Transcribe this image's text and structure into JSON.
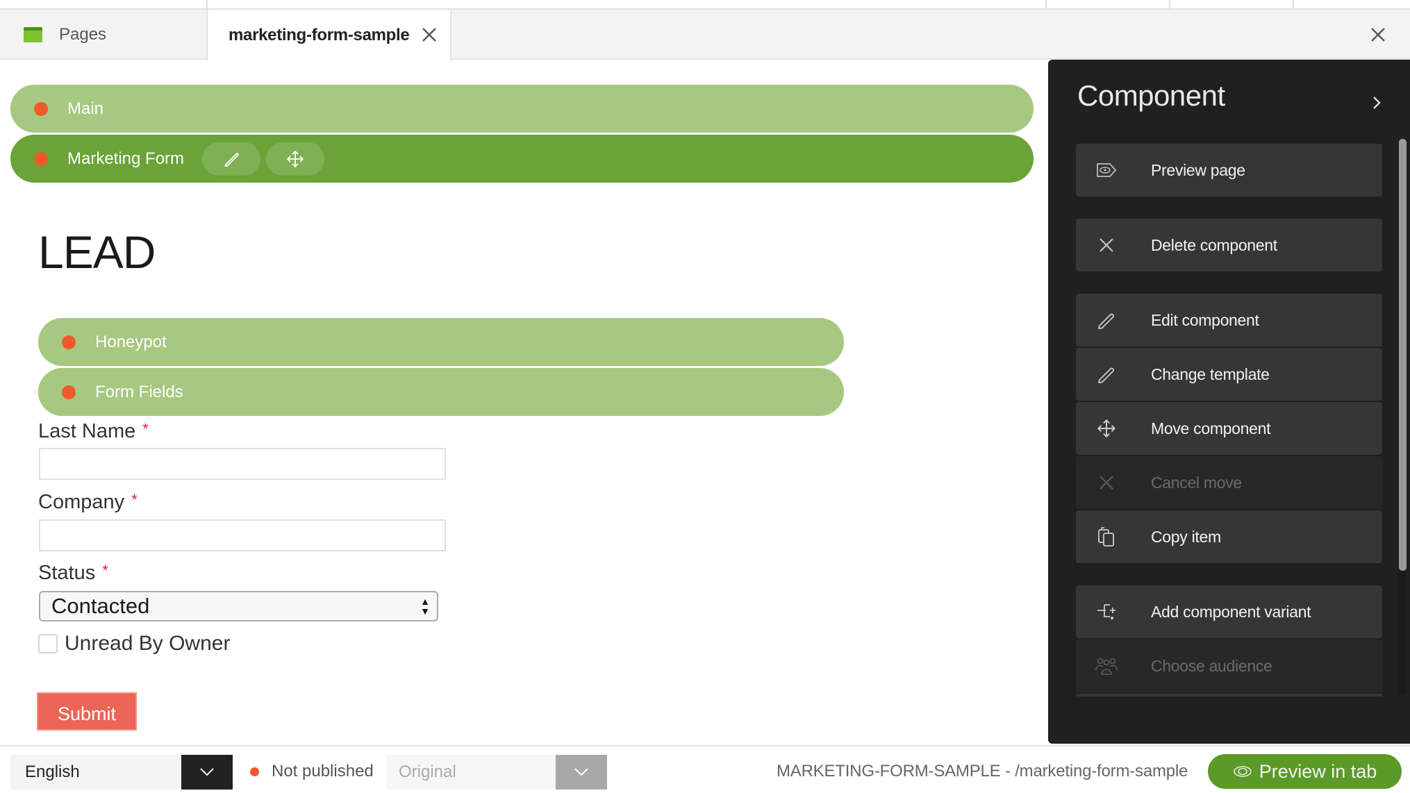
{
  "tabs": {
    "pages_label": "Pages",
    "active_label": "marketing-form-sample"
  },
  "canvas": {
    "placeholders": {
      "main": "Main",
      "marketing_form": "Marketing Form",
      "honeypot": "Honeypot",
      "form_fields": "Form Fields"
    },
    "heading": "LEAD",
    "form": {
      "last_name_label": "Last Name",
      "last_name_value": "",
      "company_label": "Company",
      "company_value": "",
      "status_label": "Status",
      "status_selected": "Contacted",
      "required_mark": "*",
      "unread_label": "Unread By Owner",
      "unread_checked": false,
      "submit_label": "Submit"
    }
  },
  "panel": {
    "title": "Component",
    "items": [
      {
        "label": "Preview page",
        "icon": "eye-tag-icon",
        "enabled": true
      },
      {
        "label": "Delete component",
        "icon": "close-icon",
        "enabled": true
      },
      {
        "label": "Edit component",
        "icon": "pencil-icon",
        "enabled": true
      },
      {
        "label": "Change template",
        "icon": "pencil-icon",
        "enabled": true
      },
      {
        "label": "Move component",
        "icon": "move-icon",
        "enabled": true
      },
      {
        "label": "Cancel move",
        "icon": "close-icon",
        "enabled": false
      },
      {
        "label": "Copy item",
        "icon": "copy-icon",
        "enabled": true
      },
      {
        "label": "Add component variant",
        "icon": "add-variant-icon",
        "enabled": true
      },
      {
        "label": "Choose audience",
        "icon": "audience-icon",
        "enabled": false
      }
    ]
  },
  "bottom": {
    "language": "English",
    "publish_status": "Not published",
    "variant": "Original",
    "page_path": "MARKETING-FORM-SAMPLE - /marketing-form-sample",
    "preview_label": "Preview in tab"
  },
  "colors": {
    "placeholder_light": "#a6c880",
    "placeholder_selected": "#6aa337",
    "status_dot": "#f05a2b",
    "submit": "#ec6557",
    "panel_bg": "#202020",
    "preview_button": "#5c9a28"
  }
}
